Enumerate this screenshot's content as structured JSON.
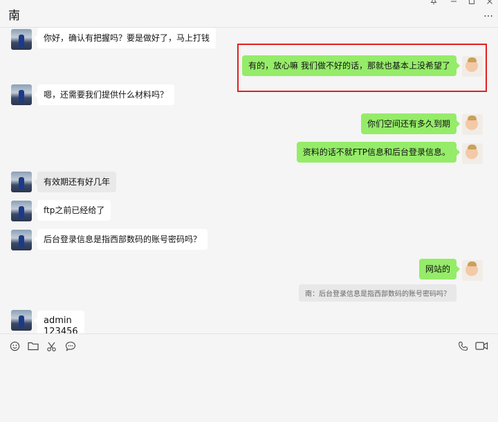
{
  "window": {
    "title": "南",
    "controls": [
      "pin-icon",
      "minimize-icon",
      "maximize-icon",
      "close-icon"
    ],
    "more_label": "…"
  },
  "messages": [
    {
      "side": "left",
      "text": "你好，确认有把握吗？要是做好了，马上打钱"
    },
    {
      "side": "right",
      "text": "有的，放心嘛 我们做不好的话，那就也基本上没希望了"
    },
    {
      "side": "left",
      "text": "嗯，还需要我们提供什么材料吗？"
    },
    {
      "side": "right",
      "text": "你们空间还有多久到期"
    },
    {
      "side": "right",
      "text": "资料的话不就FTP信息和后台登录信息。"
    },
    {
      "side": "left",
      "text": "有效期还有好几年"
    },
    {
      "side": "left",
      "text": "ftp之前已经给了"
    },
    {
      "side": "left",
      "text": "后台登录信息是指西部数码的账号密码吗？"
    },
    {
      "side": "right",
      "text": "网站的"
    },
    {
      "side": "left",
      "text": "admin\n123456"
    }
  ],
  "quote": {
    "text": "南：后台登录信息是指西部数码的账号密码吗？"
  },
  "toolbar": {
    "left_icons": [
      "emoji-icon",
      "folder-icon",
      "scissors-icon",
      "chat-bubble-icon"
    ],
    "right_icons": [
      "phone-icon",
      "video-camera-icon"
    ]
  },
  "colors": {
    "background": "#f5f5f5",
    "outgoing_bubble": "#95ec69",
    "incoming_bubble": "#ffffff",
    "highlight_border": "#e02020"
  }
}
